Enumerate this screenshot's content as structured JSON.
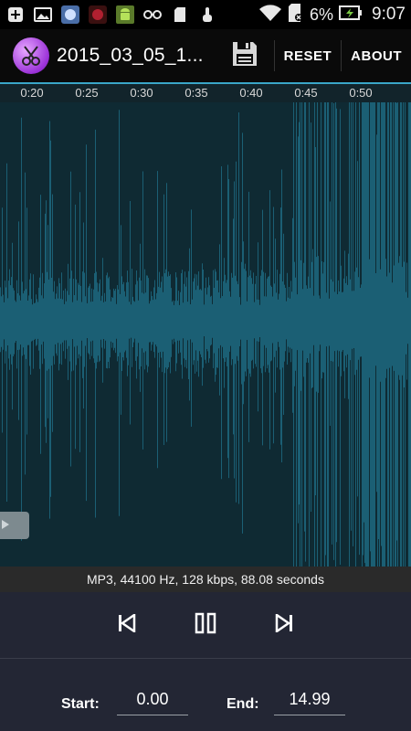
{
  "status_bar": {
    "icons": [
      "plus-box-icon",
      "image-icon",
      "messenger-icon",
      "record-icon",
      "android-icon",
      "glasses-icon",
      "sd-card-icon",
      "touch-icon",
      "wifi-icon",
      "no-sim-icon",
      "battery-charging-icon"
    ],
    "battery_percent": "6%",
    "time": "9:07"
  },
  "action_bar": {
    "title": "2015_03_05_1...",
    "save_icon": "floppy-disk-icon",
    "reset_label": "RESET",
    "about_label": "ABOUT"
  },
  "timeline": {
    "ticks": [
      "0:20",
      "0:25",
      "0:30",
      "0:35",
      "0:40",
      "0:45",
      "0:50"
    ]
  },
  "waveform": {
    "color": "#1b5f74",
    "background": "#0f2a33"
  },
  "info": {
    "text": "MP3, 44100 Hz, 128 kbps, 88.08 seconds"
  },
  "controls": {
    "prev_icon": "skip-previous-icon",
    "pause_icon": "pause-icon",
    "next_icon": "skip-next-icon"
  },
  "range": {
    "start_label": "Start:",
    "start_value": "0.00",
    "end_label": "End:",
    "end_value": "14.99"
  },
  "colors": {
    "accent": "#3aa6c8",
    "control_bg": "#232634"
  }
}
